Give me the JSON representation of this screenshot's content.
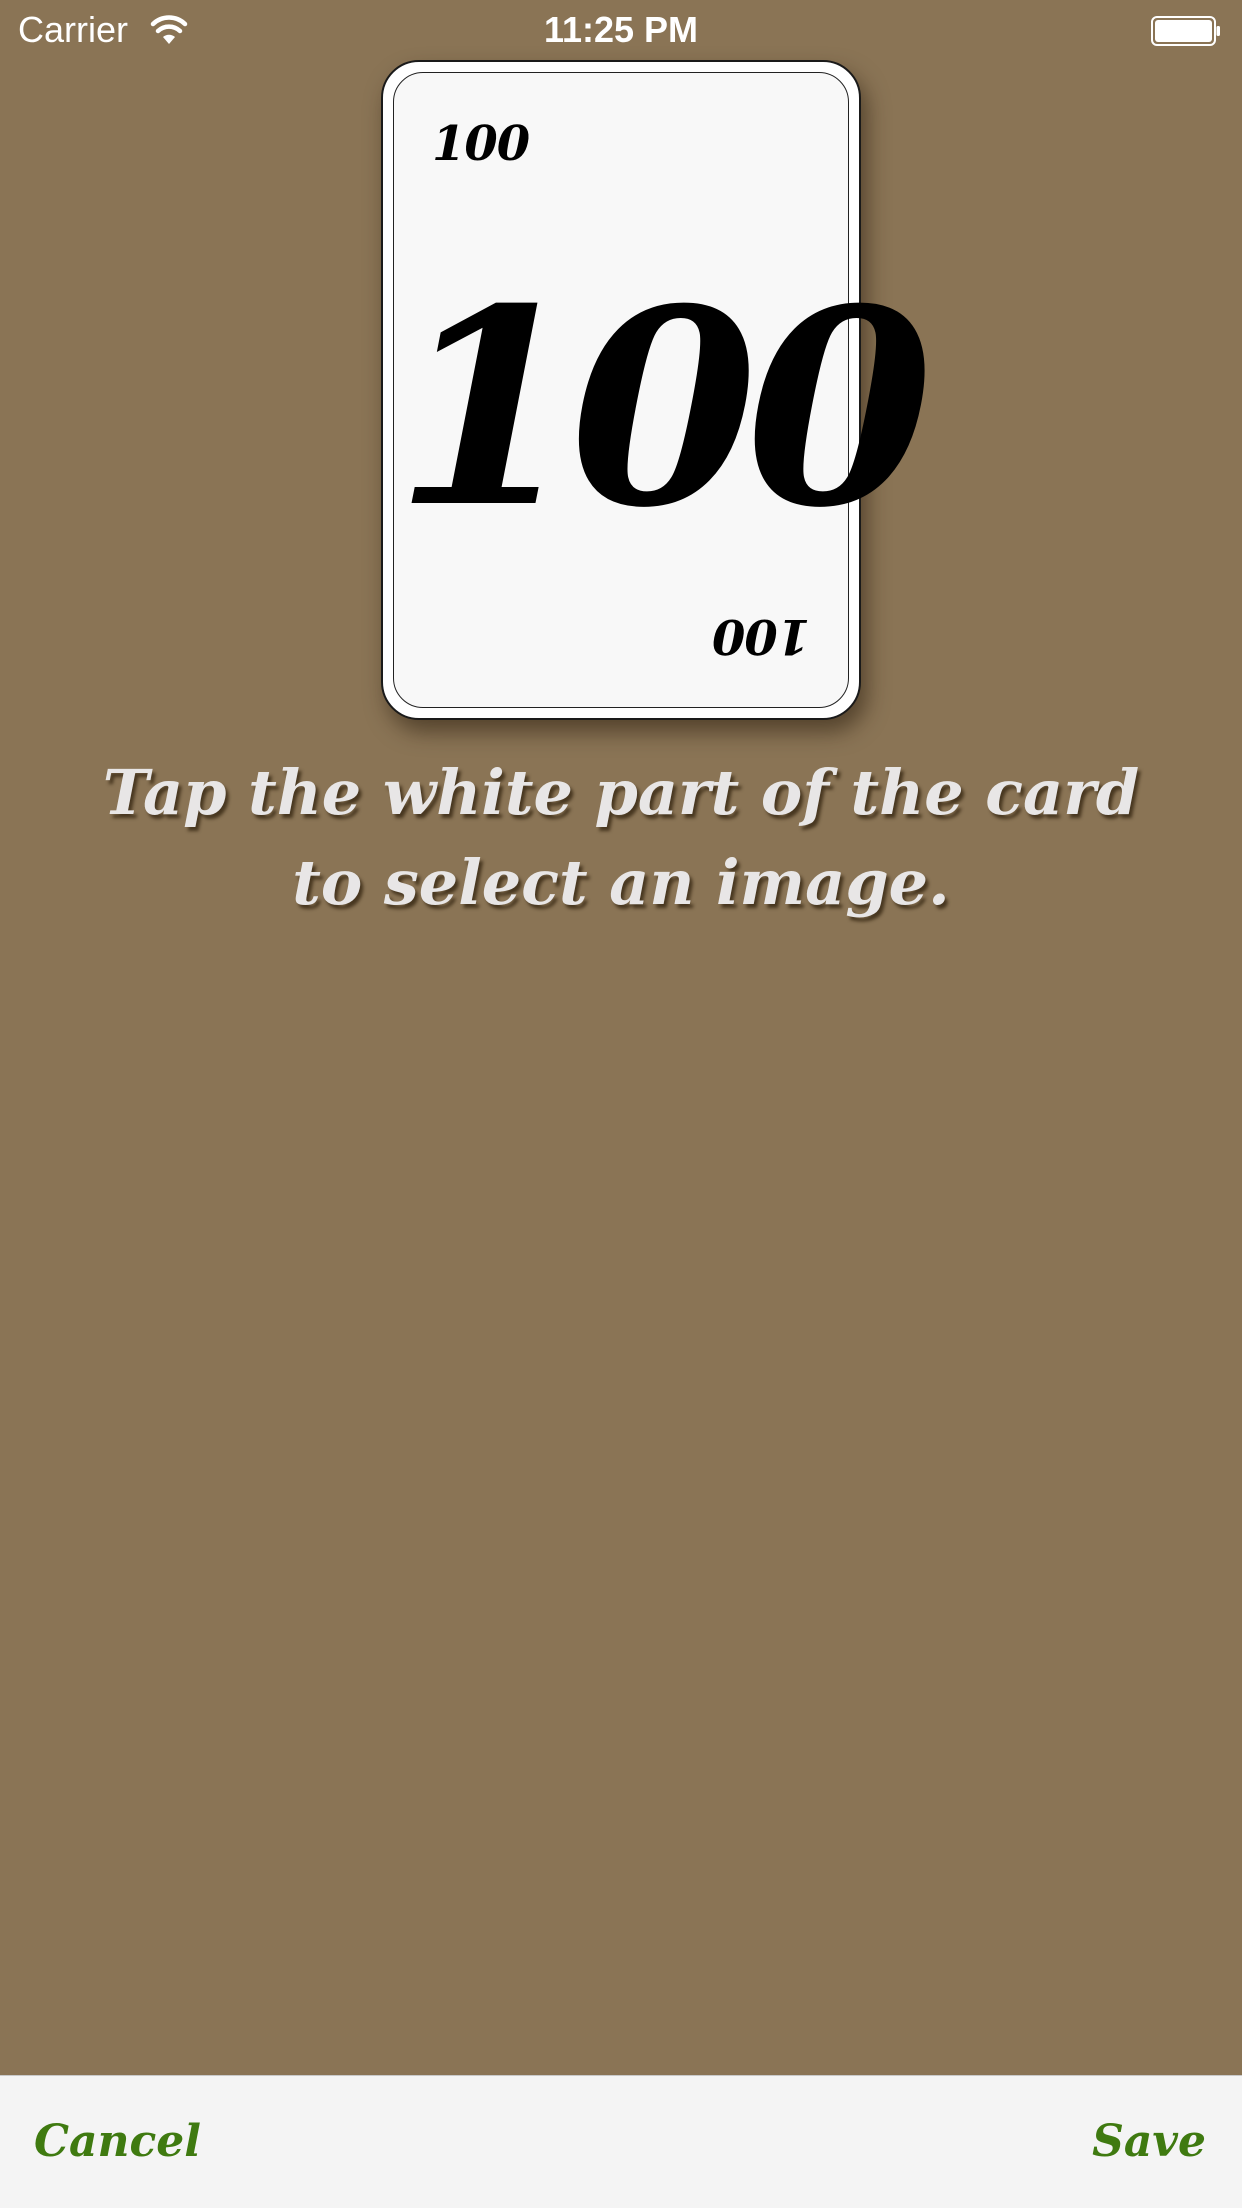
{
  "status_bar": {
    "carrier": "Carrier",
    "time": "11:25 PM",
    "icons": [
      "wifi-icon",
      "battery-icon"
    ]
  },
  "card": {
    "value": "100",
    "corner_top": "100",
    "corner_bottom": "100"
  },
  "instruction": {
    "text": "Tap the white part of the card to select an image."
  },
  "toolbar": {
    "cancel_label": "Cancel",
    "save_label": "Save"
  },
  "colors": {
    "background": "#8a7455",
    "accent": "#3f7a10",
    "card": "#f8f8f8",
    "toolbar": "#f4f4f4"
  }
}
